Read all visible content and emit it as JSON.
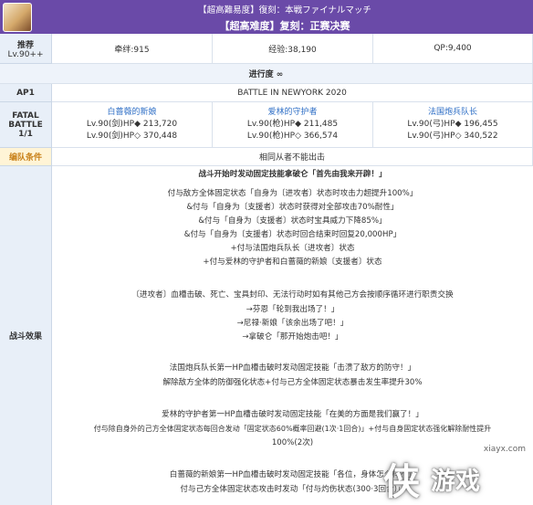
{
  "header": {
    "subtitle": "【超高難易度】復刻：本戦ファイナルマッチ",
    "title": "【超高难度】复刻：正赛决赛"
  },
  "stats": {
    "recommend_label": "推荐",
    "level_label": "Lv.90++",
    "bond": "牵绊:915",
    "exp": "经验:38,190",
    "qp": "QP:9,400"
  },
  "progress": "进行度 ∞",
  "ap": {
    "label": "AP1",
    "stage_name": "BATTLE IN NEWYORK 2020"
  },
  "battle": {
    "label_top": "FATAL",
    "label_mid": "BATTLE",
    "label_bottom": "1/1",
    "enemies": [
      {
        "name": "白蔷薇的新娘",
        "line1": "Lv.90(剑)HP◆ 213,720",
        "line2": "Lv.90(剑)HP◇ 370,448"
      },
      {
        "name": "爱林的守护者",
        "line1": "Lv.90(枪)HP◆ 211,485",
        "line2": "Lv.90(枪)HP◇ 366,574"
      },
      {
        "name": "法国炮兵队长",
        "line1": "Lv.90(弓)HP◆ 196,455",
        "line2": "Lv.90(弓)HP◇ 340,522"
      }
    ]
  },
  "team_condition": {
    "label": "编队条件",
    "value": "相同从者不能出击"
  },
  "effects": {
    "label": "战斗效果",
    "lines": [
      "战斗开始时发动固定技能拿破仑「首先由我来开辟！」",
      "付与敌方全体固定状态「自身为〔进攻者〕状态时攻击力超提升100%」",
      "&付与「自身为〔支援者〕状态时获得对全部攻击70%耐性」",
      "&付与「自身为〔支援者〕状态时宝具威力下降85%」",
      "&付与「自身为〔支援者〕状态时回合结束时回复20,000HP」",
      "+付与法国炮兵队长〔进攻者〕状态",
      "+付与爱林的守护者和白蔷薇的新娘〔支援者〕状态",
      "〔进攻者〕血槽击破、死亡、宝具封印、无法行动时如有其他己方会按顺序循环进行职责交换",
      "→芬恩「轮到我出场了！」",
      "→尼禄·新娘「该余出场了吧！」",
      "→拿破仑「那开始炮击吧！」",
      "法国炮兵队长第一HP血槽击破时发动固定技能「击溃了敌方的防守！」",
      "解除敌方全体的防御强化状态+付与己方全体固定状态暴击发生率提升30%",
      "爱林的守护者第一HP血槽击破时发动固定技能「在美的方面是我们赢了！」",
      "付与除自身外的己方全体固定状态每回合发动「固定状态60%概率回避(1次·1回合)」+付与自身固定状态强化解除耐性提升",
      "100%(2次)",
      "白蔷薇的新娘第一HP血槽击破时发动固定技能「各位，身体怎么样？」",
      "付与己方全体固定状态攻击时发动「付与灼伤状态(300·3回合)」"
    ]
  },
  "watermark": {
    "site": "xiayx.com",
    "glyph": "侠",
    "text": "游戏"
  },
  "colors": {
    "header": "#6a4aa8",
    "label_bg": "#e8eff8",
    "link": "#2f6fc6",
    "cond_bg": "#fff4d6"
  }
}
